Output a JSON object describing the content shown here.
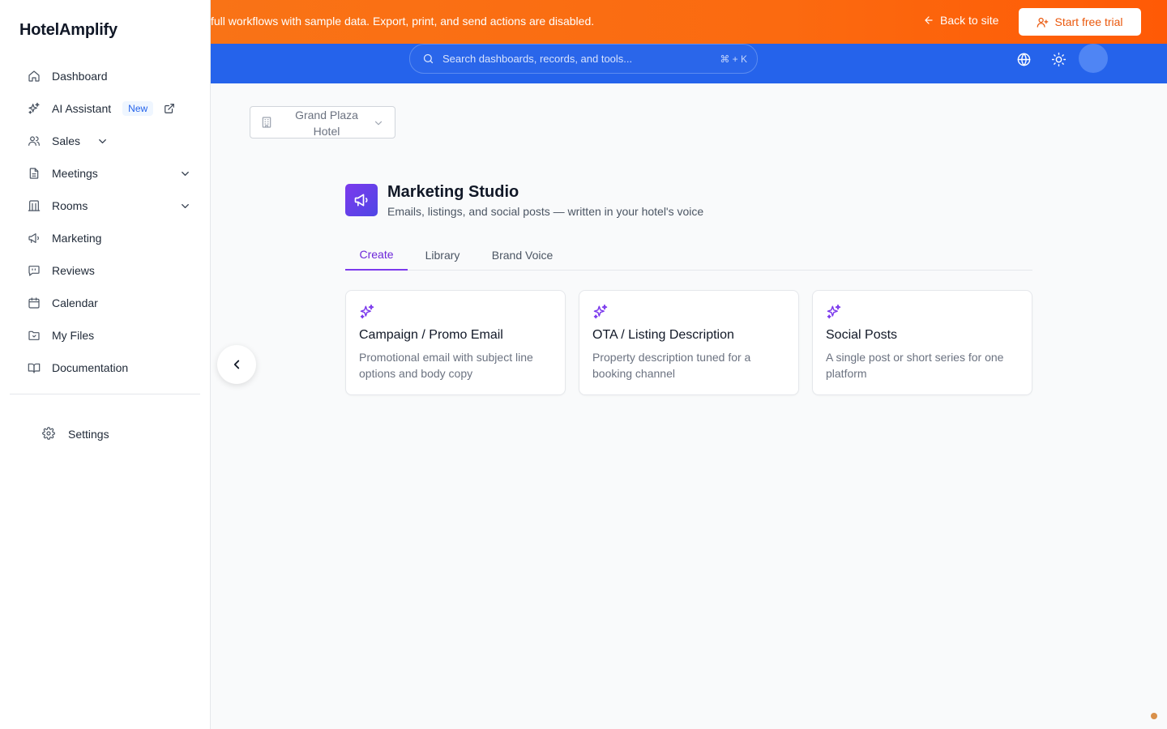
{
  "app": {
    "brand": "HotelAmplify"
  },
  "sidebar": {
    "items": [
      {
        "label": "Dashboard",
        "icon": "home-icon"
      },
      {
        "label": "AI Assistant",
        "icon": "sparkles-icon",
        "badge": "New"
      },
      {
        "label": "Sales",
        "icon": "users-icon"
      },
      {
        "label": "Meetings",
        "icon": "document-icon"
      },
      {
        "label": "Rooms",
        "icon": "building-columns-icon"
      },
      {
        "label": "Marketing",
        "icon": "megaphone-icon"
      },
      {
        "label": "Reviews",
        "icon": "message-quote-icon"
      },
      {
        "label": "Calendar",
        "icon": "calendar-icon"
      },
      {
        "label": "My Files",
        "icon": "folder-icon"
      },
      {
        "label": "Documentation",
        "icon": "book-open-icon"
      }
    ],
    "settings_label": "Settings"
  },
  "banner": {
    "text": "full workflows with sample data. Export, print, and send actions are disabled.",
    "back_label": "Back to site",
    "trial_label": "Start free trial"
  },
  "topbar": {
    "search_placeholder": "Search dashboards, records, and tools...",
    "shortcut": "⌘ + K"
  },
  "hotel_selector": {
    "value": "Grand Plaza Hotel"
  },
  "studio": {
    "title": "Marketing Studio",
    "subtitle": "Emails, listings, and social posts — written in your hotel's voice",
    "tabs": [
      "Create",
      "Library",
      "Brand Voice"
    ],
    "active_tab": "Create",
    "cards": [
      {
        "title": "Campaign / Promo Email",
        "description": "Promotional email with subject line options and body copy"
      },
      {
        "title": "OTA / Listing Description",
        "description": "Property description tuned for a booking channel"
      },
      {
        "title": "Social Posts",
        "description": "A single post or short series for one platform"
      }
    ]
  },
  "colors": {
    "accent_purple": "#7c3aed",
    "topbar_blue": "#2563eb",
    "banner_orange": "#f97316"
  }
}
